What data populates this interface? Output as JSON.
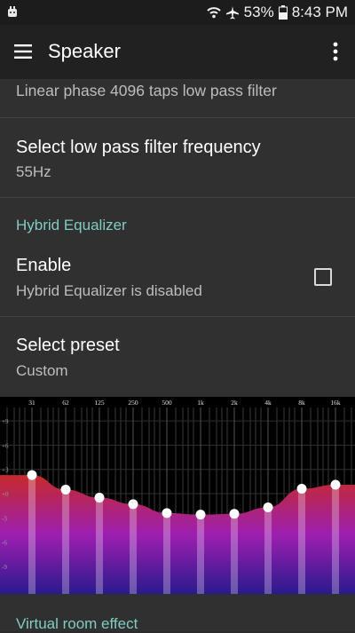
{
  "status_bar": {
    "battery_percent": "53%",
    "time": "8:43 PM",
    "icons": [
      "notification-icon",
      "wifi-icon",
      "airplane-mode-icon",
      "battery-icon"
    ]
  },
  "toolbar": {
    "title": "Speaker",
    "menu_icon": "hamburger-menu-icon",
    "overflow_icon": "more-vertical-icon"
  },
  "preferences": {
    "low_pass_type": {
      "summary": "Linear phase 4096 taps low pass filter"
    },
    "low_pass_frequency": {
      "title": "Select low pass filter frequency",
      "summary": "55Hz"
    },
    "hybrid_eq_category": "Hybrid Equalizer",
    "enable": {
      "title": "Enable",
      "summary": "Hybrid Equalizer is disabled",
      "checked": false
    },
    "preset": {
      "title": "Select preset",
      "summary": "Custom"
    },
    "virtual_room_category": "Virtual room effect"
  },
  "equalizer": {
    "bands": [
      "31",
      "62",
      "125",
      "250",
      "500",
      "1k",
      "2k",
      "4k",
      "8k",
      "16k"
    ],
    "gains_db": [
      2.3,
      0.5,
      -0.5,
      -1.3,
      -2.4,
      -2.6,
      -2.5,
      -1.7,
      0.6,
      1.1
    ],
    "db_labels": [
      "+9",
      "+6",
      "+3",
      "+0",
      "-3",
      "-6",
      "-9"
    ],
    "db_range": [
      -12,
      12
    ],
    "accent_colors": [
      "#c62a2a",
      "#9d1fb0",
      "#2a1a8e"
    ]
  }
}
